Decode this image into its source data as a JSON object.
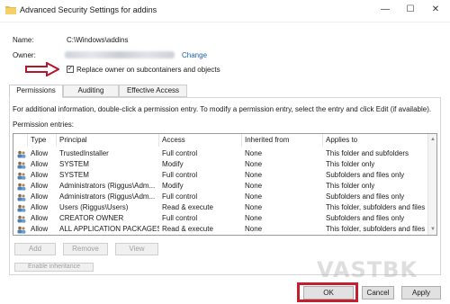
{
  "window": {
    "title": "Advanced Security Settings for addins",
    "controls": {
      "minimize": "—",
      "maximize": "☐",
      "close": "✕"
    }
  },
  "name": {
    "label": "Name:",
    "value": "C:\\Windows\\addins"
  },
  "owner": {
    "label": "Owner:",
    "change_link": "Change"
  },
  "replace_owner": {
    "label": "Replace owner on subcontainers and objects",
    "checked": true,
    "check_glyph": "✓"
  },
  "tabs": [
    {
      "label": "Permissions",
      "active": true
    },
    {
      "label": "Auditing",
      "active": false
    },
    {
      "label": "Effective Access",
      "active": false
    }
  ],
  "info_text": "For additional information, double-click a permission entry. To modify a permission entry, select the entry and click Edit (if available).",
  "entries_label": "Permission entries:",
  "table": {
    "headers": [
      "Type",
      "Principal",
      "Access",
      "Inherited from",
      "Applies to"
    ],
    "rows": [
      {
        "type": "Allow",
        "principal": "TrustedInstaller",
        "access": "Full control",
        "inherited": "None",
        "applies": "This folder and subfolders"
      },
      {
        "type": "Allow",
        "principal": "SYSTEM",
        "access": "Modify",
        "inherited": "None",
        "applies": "This folder only"
      },
      {
        "type": "Allow",
        "principal": "SYSTEM",
        "access": "Full control",
        "inherited": "None",
        "applies": "Subfolders and files only"
      },
      {
        "type": "Allow",
        "principal": "Administrators (Riggus\\Adm...",
        "access": "Modify",
        "inherited": "None",
        "applies": "This folder only"
      },
      {
        "type": "Allow",
        "principal": "Administrators (Riggus\\Adm...",
        "access": "Full control",
        "inherited": "None",
        "applies": "Subfolders and files only"
      },
      {
        "type": "Allow",
        "principal": "Users (Riggus\\Users)",
        "access": "Read & execute",
        "inherited": "None",
        "applies": "This folder, subfolders and files"
      },
      {
        "type": "Allow",
        "principal": "CREATOR OWNER",
        "access": "Full control",
        "inherited": "None",
        "applies": "Subfolders and files only"
      },
      {
        "type": "Allow",
        "principal": "ALL APPLICATION PACKAGES",
        "access": "Read & execute",
        "inherited": "None",
        "applies": "This folder, subfolders and files"
      }
    ]
  },
  "list_buttons": {
    "add": "Add",
    "remove": "Remove",
    "view": "View"
  },
  "enable_inheritance": "Enable inheritance",
  "dialog_buttons": {
    "ok": "OK",
    "cancel": "Cancel",
    "apply": "Apply"
  },
  "watermark": "VASTBK",
  "colors": {
    "highlight": "#c31f2e",
    "link": "#1a5fb4",
    "arrow": "#b8142a"
  }
}
